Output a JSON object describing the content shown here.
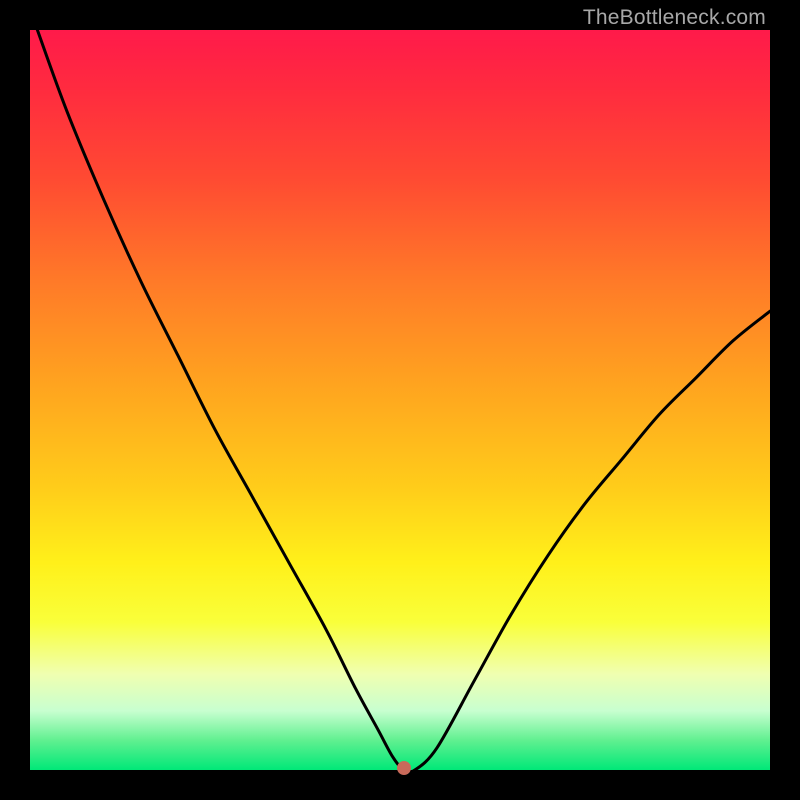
{
  "watermark": {
    "text": "TheBottleneck.com"
  },
  "chart_data": {
    "type": "line",
    "title": "",
    "xlabel": "",
    "ylabel": "",
    "xlim": [
      0,
      100
    ],
    "ylim": [
      0,
      100
    ],
    "marker": {
      "x": 50.5,
      "y": 0
    },
    "series": [
      {
        "name": "curve",
        "x": [
          1,
          5,
          10,
          15,
          20,
          25,
          30,
          35,
          40,
          44,
          47,
          49,
          50.5,
          52,
          55,
          60,
          65,
          70,
          75,
          80,
          85,
          90,
          95,
          100
        ],
        "values": [
          100,
          89,
          77,
          66,
          56,
          46,
          37,
          28,
          19,
          11,
          5.5,
          1.8,
          0,
          0,
          3,
          12,
          21,
          29,
          36,
          42,
          48,
          53,
          58,
          62
        ]
      }
    ],
    "background_gradient": {
      "stops": [
        {
          "pos": 0.0,
          "color": "#ff1a4a"
        },
        {
          "pos": 0.5,
          "color": "#ffa41f"
        },
        {
          "pos": 0.8,
          "color": "#f9ff3a"
        },
        {
          "pos": 1.0,
          "color": "#00e878"
        }
      ]
    }
  }
}
